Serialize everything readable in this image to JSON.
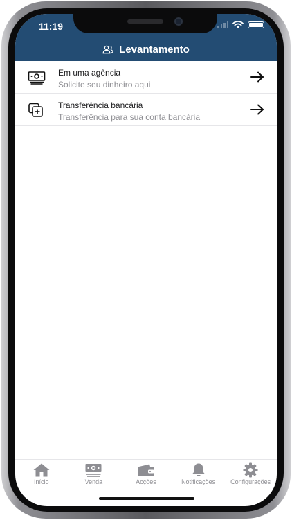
{
  "status_bar": {
    "time": "11:19"
  },
  "header": {
    "title": "Levantamento",
    "icon": "users-icon"
  },
  "options": [
    {
      "title": "Em uma agência",
      "subtitle": "Solicite seu dinheiro aqui",
      "icon": "cash-icon"
    },
    {
      "title": "Transferência bancária",
      "subtitle": "Transferência para sua conta bancária",
      "icon": "add-copy-icon"
    }
  ],
  "tabbar": {
    "items": [
      {
        "label": "Início",
        "icon": "home-icon"
      },
      {
        "label": "Venda",
        "icon": "cash-icon"
      },
      {
        "label": "Acções",
        "icon": "wallet-icon"
      },
      {
        "label": "Notificações",
        "icon": "bell-icon"
      },
      {
        "label": "Configurações",
        "icon": "gear-icon"
      }
    ]
  },
  "colors": {
    "header_bg": "#234c73",
    "header_text": "#ffffff",
    "subtitle": "#8e8e93",
    "tab_inactive": "#8e8e93"
  }
}
